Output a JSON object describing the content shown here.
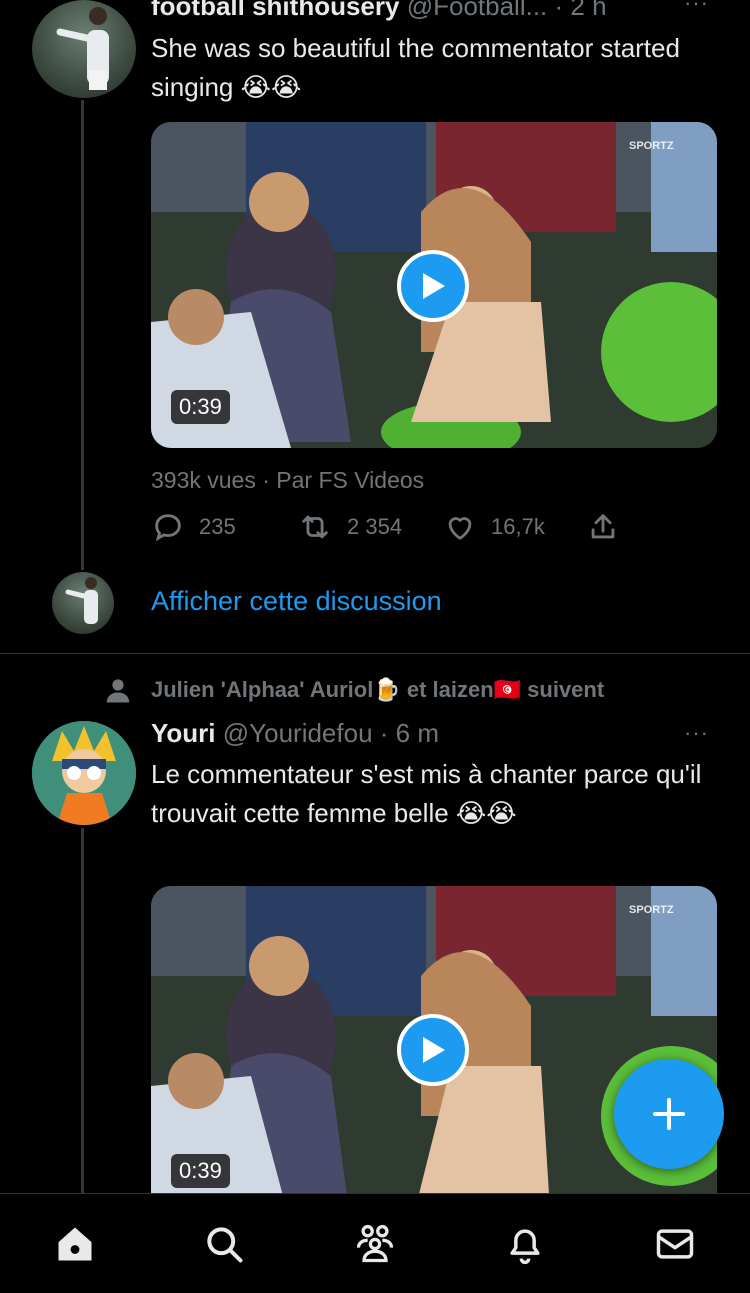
{
  "tweet1": {
    "display_name": "football shithousery",
    "handle": "@Football...",
    "time": "· 2 h",
    "more": "···",
    "text": "She was so beautiful the commentator started singing 😭😭",
    "video": {
      "duration": "0:39",
      "watermark": "SPORTZ"
    },
    "meta": "393k vues · Par FS Videos",
    "actions": {
      "replies": "235",
      "retweets": "2 354",
      "likes": "16,7k"
    }
  },
  "thread_link": {
    "label": "Afficher cette discussion"
  },
  "social_context": {
    "text": "Julien 'Alphaa' Auriol🍺 et laizen🇹🇳 suivent"
  },
  "tweet2": {
    "display_name": "Youri",
    "handle": "@Youridefou",
    "time": "· 6 m",
    "more": "···",
    "text": "Le commentateur s'est mis à chanter parce qu'il trouvait cette femme belle 😭😭",
    "video": {
      "duration": "0:39",
      "watermark": "SPORTZ"
    }
  },
  "colors": {
    "accent": "#1d9bf0",
    "muted": "#71767b",
    "background": "#000000"
  },
  "nav": [
    "home-icon",
    "search-icon",
    "communities-icon",
    "notifications-icon",
    "messages-icon"
  ]
}
